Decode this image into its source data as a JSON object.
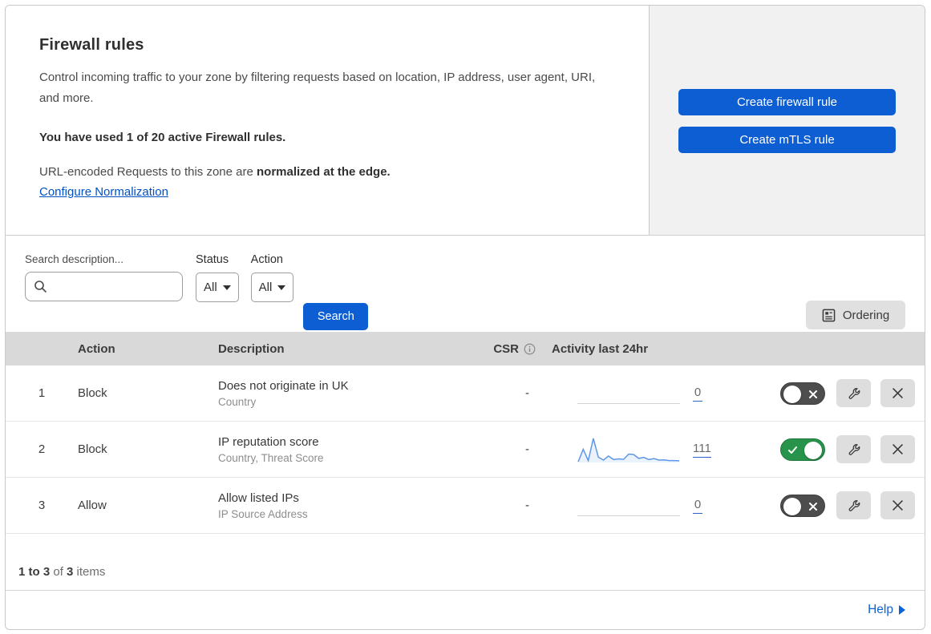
{
  "header": {
    "title": "Firewall rules",
    "description": "Control incoming traffic to your zone by filtering requests based on location, IP address, user agent, URI, and more.",
    "usage": "You have used 1 of 20 active Firewall rules.",
    "normalization_text": "URL-encoded Requests to this zone are ",
    "normalization_bold": "normalized at the edge.",
    "normalization_link": "Configure Normalization",
    "buttons": [
      {
        "label": "Create firewall rule"
      },
      {
        "label": "Create mTLS rule"
      }
    ]
  },
  "filters": {
    "search_label": "Search description...",
    "search_value": "",
    "status_label": "Status",
    "status_value": "All",
    "action_label": "Action",
    "action_value": "All",
    "search_button": "Search",
    "ordering_button": "Ordering"
  },
  "table": {
    "columns": {
      "action": "Action",
      "description": "Description",
      "csr": "CSR",
      "activity": "Activity last 24hr"
    },
    "rows": [
      {
        "priority": "1",
        "action": "Block",
        "description": "Does not originate in UK",
        "fields": "Country",
        "csr": "-",
        "count": "0",
        "enabled": false,
        "sparkline": []
      },
      {
        "priority": "2",
        "action": "Block",
        "description": "IP reputation score",
        "fields": "Country, Threat Score",
        "csr": "-",
        "count": "111",
        "enabled": true,
        "sparkline": [
          3,
          55,
          8,
          100,
          22,
          10,
          27,
          12,
          15,
          13,
          35,
          33,
          17,
          21,
          12,
          16,
          10,
          11,
          8,
          8,
          7
        ]
      },
      {
        "priority": "3",
        "action": "Allow",
        "description": "Allow listed IPs",
        "fields": "IP Source Address",
        "csr": "-",
        "count": "0",
        "enabled": false,
        "sparkline": []
      }
    ]
  },
  "footer": {
    "range": "1 to 3",
    "of": " of ",
    "total": "3",
    "items": " items",
    "help_label": "Help"
  },
  "icons": {
    "search_icon": "magnifier",
    "info_icon": "circled-i",
    "ordering_icon": "list-document",
    "wrench_icon": "wrench",
    "close_icon": "x-cross",
    "toggle_off_icon": "x-cross",
    "toggle_on_icon": "checkmark",
    "dropdown_caret": "▾",
    "help_arrow": "▶"
  },
  "colors": {
    "accent_blue": "#0d5dd3",
    "link_blue": "#0051c3",
    "toggle_green": "#28944b",
    "toggle_gray": "#4d4d4d",
    "panel_gray": "#f1f1f1",
    "table_header_gray": "#d9d9d9",
    "sparkline_blue": "#5f97e8"
  }
}
